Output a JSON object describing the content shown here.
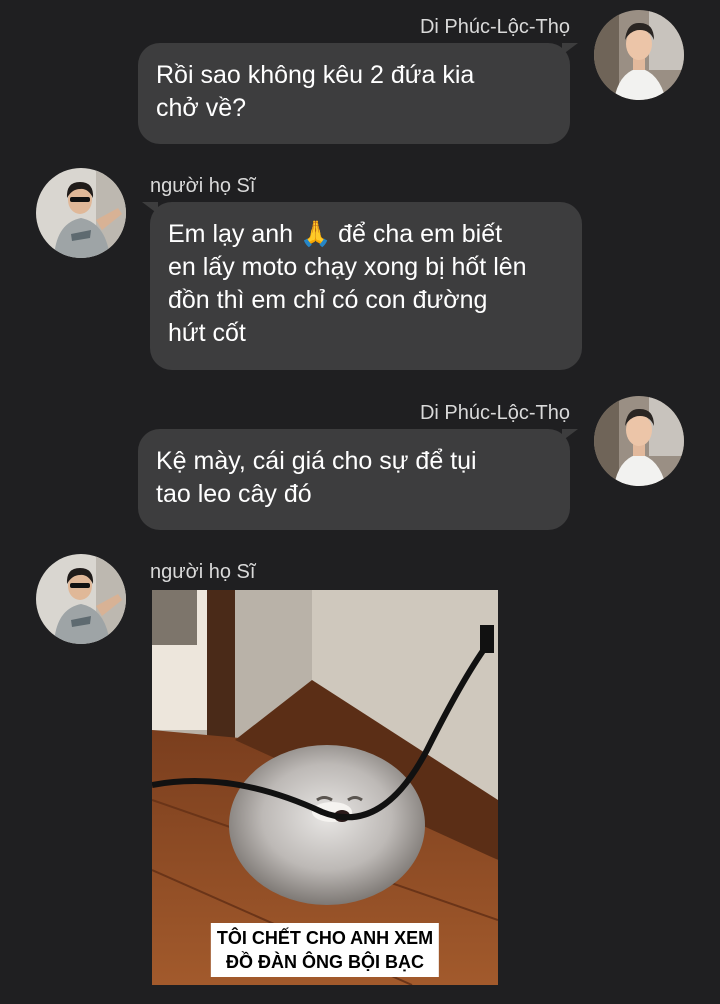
{
  "chat": {
    "messages": [
      {
        "sender": "Di Phúc-Lộc-Thọ",
        "lines": [
          "Rồi sao không kêu 2 đứa kia",
          "chở về?"
        ],
        "avatar_icon": "man-white-shirt-avatar-icon"
      },
      {
        "sender": "người họ Sĩ",
        "lines": [
          "Em lạy anh 🙏 để cha em biết",
          "en lấy moto chạy xong bị hốt lên",
          "đồn thì em chỉ có con đường",
          "hứt cốt"
        ],
        "avatar_icon": "man-sunglasses-avatar-icon"
      },
      {
        "sender": "Di Phúc-Lộc-Thọ",
        "lines": [
          "Kệ mày, cái giá cho sự để tụi",
          "tao leo cây đó"
        ],
        "avatar_icon": "man-white-shirt-avatar-icon"
      },
      {
        "sender": "người họ Sĩ",
        "image_icon": "fluffy-cat-biting-cable-meme-icon",
        "caption_lines": [
          "TÔI CHẾT CHO ANH XEM",
          "ĐỒ ĐÀN ÔNG BỘI BẠC"
        ],
        "avatar_icon": "man-sunglasses-avatar-icon"
      }
    ]
  },
  "colors": {
    "background": "#1f1f21",
    "bubble": "#3d3d3e",
    "text": "#ffffff",
    "sender": "#d9d9d9"
  }
}
